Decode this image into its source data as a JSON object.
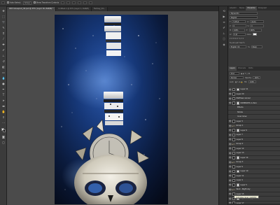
{
  "options": {
    "auto_select_label": "Auto-Select:",
    "auto_select_value": "Group",
    "show_transform_label": "Show Transform Controls"
  },
  "tabs": [
    "DK5 Gravepool_40.psd @ 25% (Layer 16, RGB/8) *",
    "Untitled-1 @ 25% (Layer 1, RGB/8)",
    "Fantasy_04..."
  ],
  "tooltip": "Indicates layer visibility",
  "panel_tabs_top": [
    "Adjustm",
    "Styles",
    "Character",
    "Paragraph"
  ],
  "panel_tabs_mid": [
    "Layers",
    "Channels",
    "Paths"
  ],
  "character": {
    "font": "Myriad Pro",
    "style": "Regular",
    "size": "5.28 pt",
    "leading": "(Auto)",
    "kerning": "0",
    "tracking": "0",
    "scale_v": "100%",
    "scale_h": "100%",
    "baseline": "0 pt",
    "color_label": "Color:",
    "language": "English: US",
    "aa": "Sharp"
  },
  "layers_panel": {
    "kind": "Kind",
    "blend": "Normal",
    "opacity_label": "Opacity:",
    "opacity": "100%",
    "lock_label": "Lock:",
    "fill_label": "Fill:",
    "fill": "100%"
  },
  "layers": [
    {
      "name": "Layer 21",
      "type": "layer"
    },
    {
      "name": "Layer 20",
      "type": "layer"
    },
    {
      "name": "Matthew vanner",
      "type": "layer"
    },
    {
      "name": "DOMINOES in Zero",
      "type": "layer"
    },
    {
      "name": "Effects",
      "type": "fx"
    },
    {
      "name": "Stroke",
      "type": "fx"
    },
    {
      "name": "Inner Glow",
      "type": "fx"
    },
    {
      "name": "Layer 3",
      "type": "layer"
    },
    {
      "name": "Group 1",
      "type": "group"
    },
    {
      "name": "Layer 6",
      "type": "layer"
    },
    {
      "name": "Layer 7",
      "type": "layer"
    },
    {
      "name": "Layer 8",
      "type": "layer"
    },
    {
      "name": "Group 2",
      "type": "group"
    },
    {
      "name": "Layer 12",
      "type": "layer"
    },
    {
      "name": "Layer 13",
      "type": "layer"
    },
    {
      "name": "Layer 14",
      "type": "layer"
    },
    {
      "name": "Group 3",
      "type": "group"
    },
    {
      "name": "Layer 9",
      "type": "layer"
    },
    {
      "name": "Layer 10",
      "type": "layer"
    },
    {
      "name": "Layer 11",
      "type": "layer"
    },
    {
      "name": "Layer 4",
      "type": "layer"
    },
    {
      "name": "Layer 5",
      "type": "layer"
    },
    {
      "name": "Skull - Night sky",
      "type": "group"
    },
    {
      "name": "Layer 15",
      "type": "layer"
    },
    {
      "name": "Layer 17 copy",
      "type": "layer"
    },
    {
      "name": "Layer 17",
      "type": "layer"
    },
    {
      "name": "Layer 16",
      "type": "layer",
      "selected": true
    },
    {
      "name": "Layer 1",
      "type": "layer"
    }
  ],
  "colors": {
    "ui_dark": "#3a3a3a",
    "selection": "#596a86",
    "night_sky": "#1c3a7a",
    "domino_white": "#e8e8e8"
  }
}
